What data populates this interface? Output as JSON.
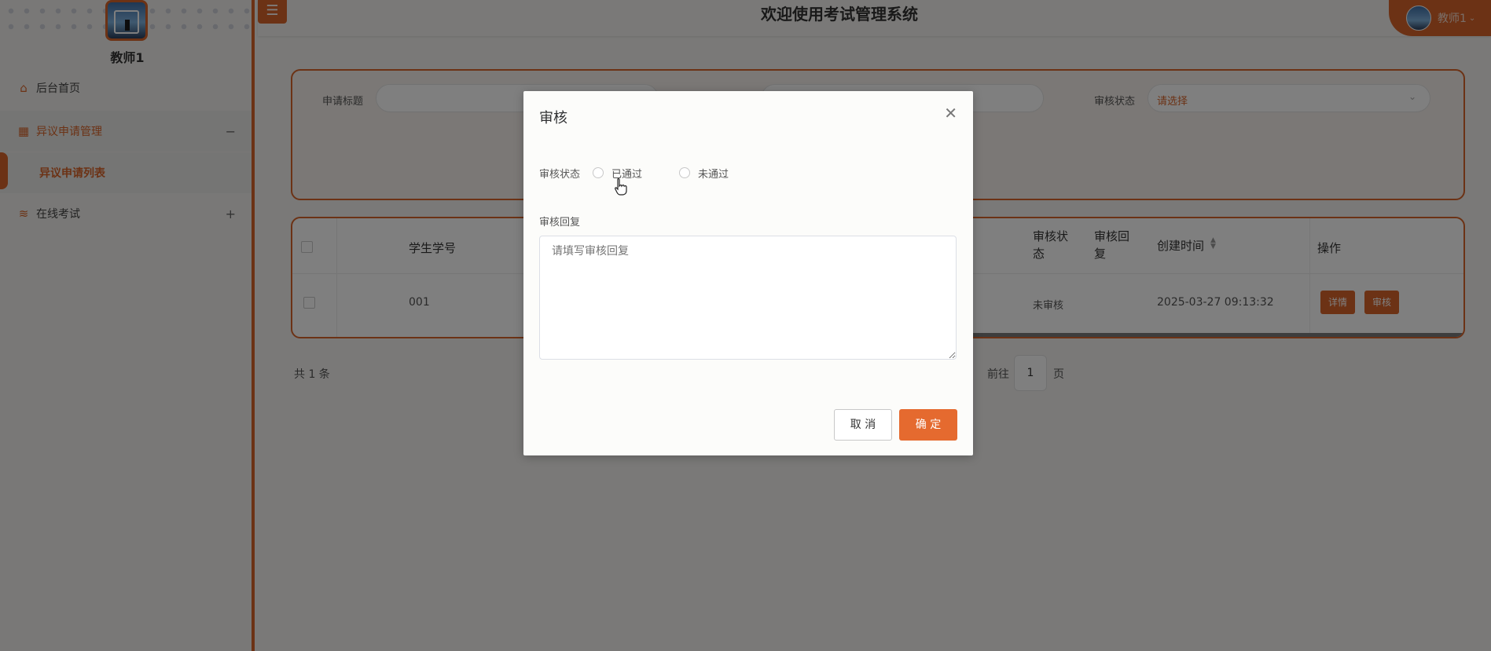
{
  "sidebar": {
    "user_name": "教师1",
    "items": [
      {
        "label": "后台首页",
        "icon": "home-icon"
      },
      {
        "label": "异议申请管理",
        "icon": "grid-icon",
        "sign": "−"
      },
      {
        "label": "异议申请列表"
      },
      {
        "label": "在线考试",
        "icon": "database-icon",
        "sign": "+"
      }
    ]
  },
  "header": {
    "title": "欢迎使用考试管理系统",
    "menu_icon": "☰",
    "user_label": "教师1"
  },
  "search": {
    "title_label": "申请标题",
    "status_label": "审核状态",
    "status_placeholder": "请选择"
  },
  "table": {
    "headers": {
      "student_no": "学生学号",
      "review_status": "审核状态",
      "review_reply": "审核回复",
      "created_time": "创建时间",
      "actions": "操作"
    },
    "rows": [
      {
        "student_no": "001",
        "review_status": "未审核",
        "review_reply": "",
        "created_time": "2025-03-27 09:13:32",
        "detail_label": "详情",
        "review_label": "审核"
      }
    ]
  },
  "pagination": {
    "total": "共 1 条",
    "goto": "前往",
    "page": "1",
    "suffix": "页"
  },
  "dialog": {
    "title": "审核",
    "status_label": "审核状态",
    "options": [
      "已通过",
      "未通过"
    ],
    "reply_label": "审核回复",
    "reply_placeholder": "请填写审核回复",
    "cancel": "取 消",
    "confirm": "确 定"
  },
  "colors": {
    "accent": "#d9652a"
  }
}
